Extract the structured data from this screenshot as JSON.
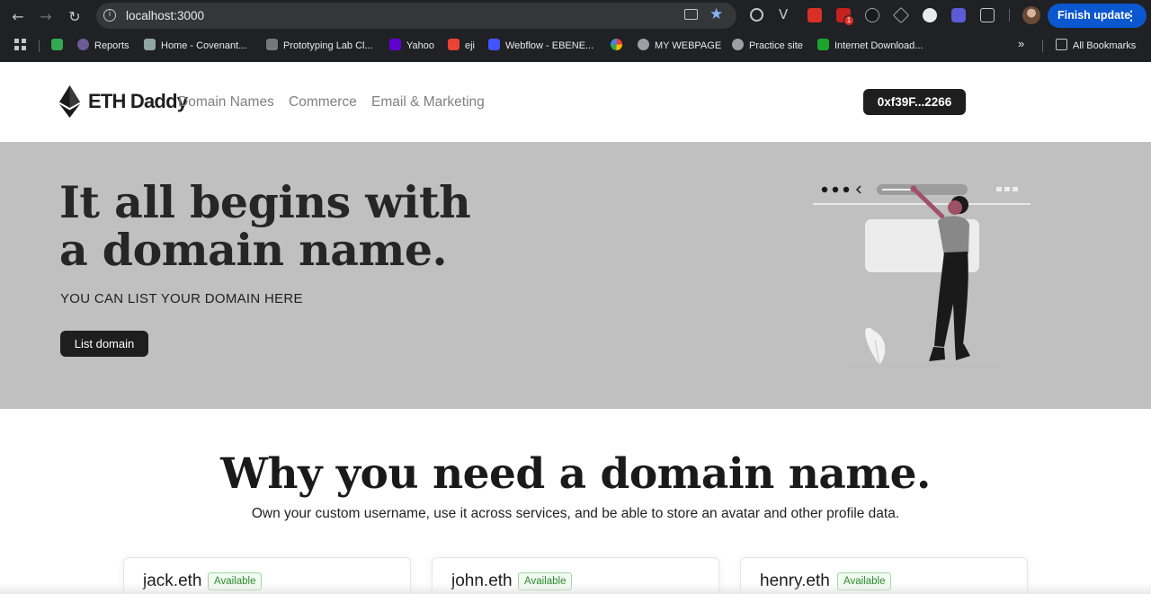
{
  "browser": {
    "url": "localhost:3000",
    "finish_update": "Finish update",
    "menu_glyph": "⋮",
    "bookmarks": [
      {
        "label": "",
        "icon": "green-square-icon"
      },
      {
        "label": "Reports",
        "icon": "reports-icon"
      },
      {
        "label": "Home - Covenant...",
        "icon": "covenant-icon"
      },
      {
        "label": "Prototyping Lab Cl...",
        "icon": "prototyping-icon"
      },
      {
        "label": "Yahoo",
        "icon": "yahoo-icon"
      },
      {
        "label": "eji",
        "icon": "gmail-icon"
      },
      {
        "label": "Webflow - EBENE...",
        "icon": "webflow-icon"
      },
      {
        "label": "",
        "icon": "google-photos-icon"
      },
      {
        "label": "MY WEBPAGE",
        "icon": "globe-icon"
      },
      {
        "label": "Practice site",
        "icon": "globe-icon"
      },
      {
        "label": "Internet Download...",
        "icon": "idm-icon"
      }
    ],
    "more_bookmarks": "»",
    "all_bookmarks": "All Bookmarks",
    "extension_badge": "1"
  },
  "nav": {
    "brand": "ETH Daddy",
    "links": [
      "Domain Names",
      "Commerce",
      "Email & Marketing"
    ],
    "wallet": "0xf39F...2266"
  },
  "hero": {
    "title": "It all begins with a domain name.",
    "subtitle": "YOU CAN LIST YOUR DOMAIN HERE",
    "button": "List domain"
  },
  "why": {
    "title": "Why you need a domain name.",
    "subtitle": "Own your custom username, use it across services, and be able to store an avatar and other profile data."
  },
  "domains": [
    {
      "name": "jack.eth",
      "status": "Available"
    },
    {
      "name": "john.eth",
      "status": "Available"
    },
    {
      "name": "henry.eth",
      "status": "Available"
    }
  ],
  "colors": {
    "hero_bg": "#c0c0c0",
    "button_bg": "#1e1e1e",
    "badge_green": "#2c8a2c",
    "chrome_bg": "#202124",
    "update_blue": "#0b57d0"
  }
}
